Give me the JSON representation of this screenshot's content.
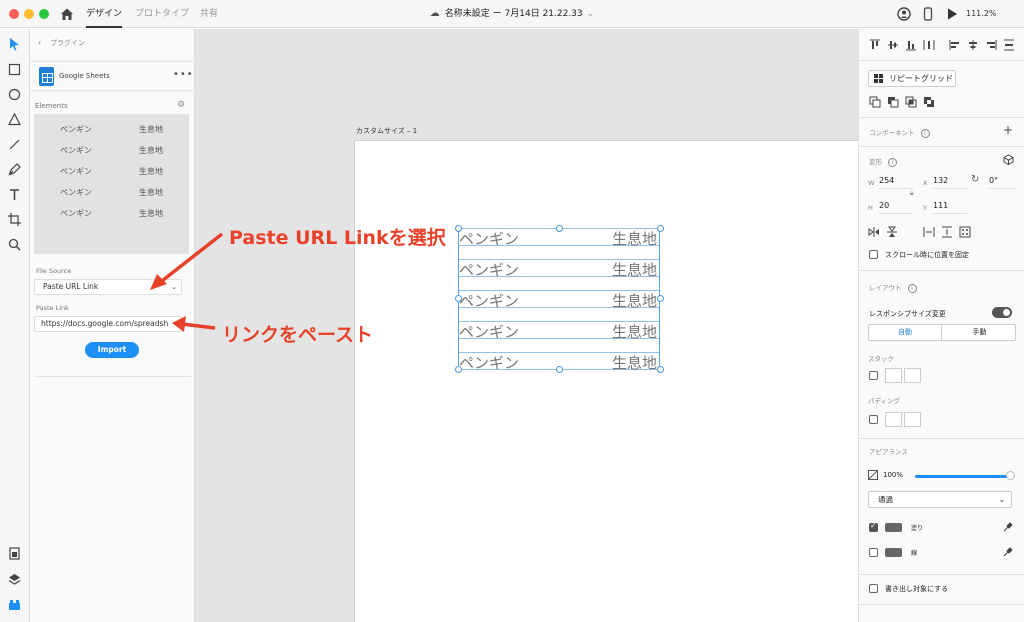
{
  "titlebar": {
    "tabs": [
      {
        "label": "デザイン",
        "active": true
      },
      {
        "label": "プロトタイプ",
        "active": false
      },
      {
        "label": "共有",
        "active": false
      }
    ],
    "doc_title": "名称未設定 ー 7月14日 21.22.33",
    "zoom": "111.2%"
  },
  "plugin": {
    "breadcrumb": "プラグイン",
    "name": "Google Sheets",
    "elements_label": "Elements",
    "elements": [
      [
        "ペンギン",
        "生息地"
      ],
      [
        "ペンギン",
        "生息地"
      ],
      [
        "ペンギン",
        "生息地"
      ],
      [
        "ペンギン",
        "生息地"
      ],
      [
        "ペンギン",
        "生息地"
      ]
    ],
    "file_source_label": "File Source",
    "file_source_value": "Paste URL Link",
    "paste_link_label": "Paste Link",
    "paste_link_value": "https://docs.google.com/spreadsh",
    "import_label": "Import"
  },
  "canvas": {
    "artboard_label": "カスタムサイズ – 1",
    "rows": [
      [
        "ペンギン",
        "生息地"
      ],
      [
        "ペンギン",
        "生息地"
      ],
      [
        "ペンギン",
        "生息地"
      ],
      [
        "ペンギン",
        "生息地"
      ],
      [
        "ペンギン",
        "生息地"
      ]
    ]
  },
  "annotations": {
    "select": "Paste URL Linkを選択",
    "paste": "リンクをペースト"
  },
  "right": {
    "repeat_grid": "リピートグリッド",
    "component": "コンポーネント",
    "transform": "変形",
    "w_key": "W",
    "w_val": "254",
    "x_key": "X",
    "x_val": "132",
    "rotation": "0°",
    "h_key": "H",
    "h_val": "20",
    "y_key": "Y",
    "y_val": "111",
    "fix_scroll": "スクロール時に位置を固定",
    "layout": "レイアウト",
    "responsive": "レスポンシブサイズ変更",
    "seg_auto": "自動",
    "seg_manual": "手動",
    "stack": "スタック",
    "padding": "パディング",
    "appearance": "アピアランス",
    "opacity": "100%",
    "opacity_value": 1.0,
    "blend": "通過",
    "fill": "塗り",
    "border": "線",
    "export": "書き出し対象にする",
    "accent_color": "#1e8ff5"
  }
}
